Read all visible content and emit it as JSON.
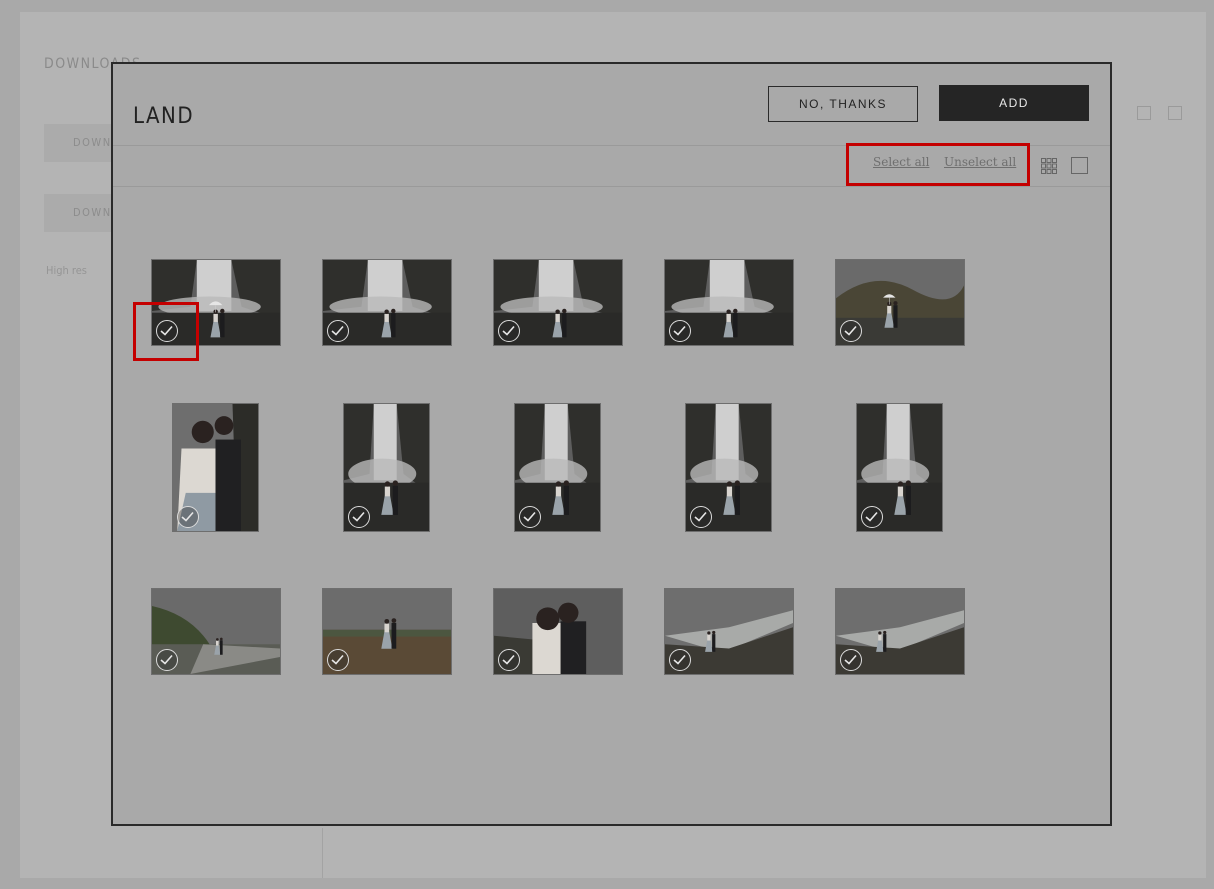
{
  "background": {
    "title": "DOWNLOADS",
    "buttons": [
      "DOWN",
      "DOWN"
    ],
    "small_text": "High res"
  },
  "modal": {
    "title": "LAND",
    "no_thanks_label": "NO, THANKS",
    "add_label": "ADD",
    "select_all_label": "Select all",
    "unselect_all_label": "Unselect all",
    "view_icons": [
      "grid-view-icon",
      "single-view-icon"
    ]
  },
  "gallery": {
    "rows": [
      {
        "orientation": "landscape",
        "photos": [
          {
            "scene": "waterfall-couple-umbrella",
            "selected": true
          },
          {
            "scene": "waterfall-couple",
            "selected": true
          },
          {
            "scene": "waterfall-couple-walking",
            "selected": true
          },
          {
            "scene": "waterfall-couple-far",
            "selected": true
          },
          {
            "scene": "hills-couple-umbrella",
            "selected": true
          }
        ]
      },
      {
        "orientation": "portrait",
        "photos": [
          {
            "scene": "couple-closeup-cliff",
            "selected": true
          },
          {
            "scene": "waterfall-couple-portrait",
            "selected": true
          },
          {
            "scene": "waterfall-couple-portrait",
            "selected": true
          },
          {
            "scene": "waterfall-couple-portrait",
            "selected": true
          },
          {
            "scene": "waterfall-couple-portrait",
            "selected": true
          }
        ]
      },
      {
        "orientation": "landscape",
        "photos": [
          {
            "scene": "road-couple",
            "selected": true
          },
          {
            "scene": "field-couple",
            "selected": true
          },
          {
            "scene": "couple-kiss",
            "selected": true
          },
          {
            "scene": "cliff-coast-couple",
            "selected": true
          },
          {
            "scene": "cliff-coast-couple",
            "selected": true
          }
        ]
      }
    ]
  },
  "colors": {
    "overlay": "#a9a9a9",
    "add_button_bg": "#252525",
    "highlight": "#c40000"
  }
}
